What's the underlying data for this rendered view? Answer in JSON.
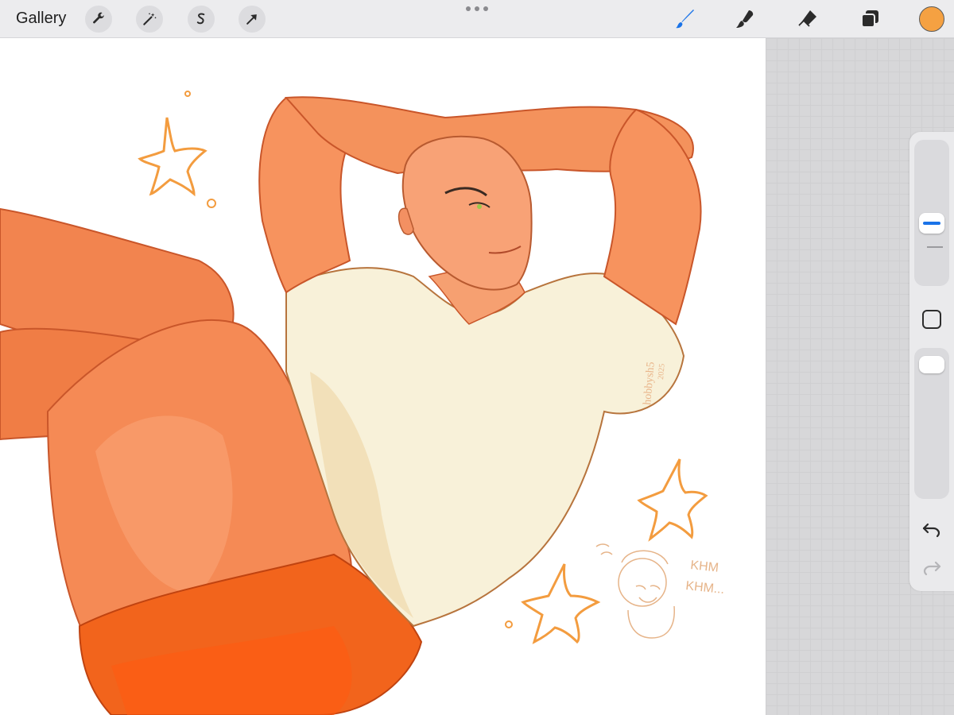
{
  "toolbar": {
    "gallery_label": "Gallery",
    "left_tools": [
      {
        "icon": "wrench-icon",
        "name": "actions"
      },
      {
        "icon": "magic-wand-icon",
        "name": "adjustments"
      },
      {
        "icon": "selection-s-icon",
        "name": "selection"
      },
      {
        "icon": "arrow-cursor-icon",
        "name": "transform"
      }
    ],
    "right_tools": [
      {
        "icon": "brush-icon",
        "name": "paint",
        "active_color": "#1a73e8"
      },
      {
        "icon": "smudge-icon",
        "name": "smudge"
      },
      {
        "icon": "eraser-icon",
        "name": "erase"
      },
      {
        "icon": "layers-icon",
        "name": "layers"
      }
    ],
    "current_color": "#f5a142"
  },
  "canvas": {
    "signature_text": "hobbysh5",
    "signature_year": "2025",
    "doodle_text_1": "KHM",
    "doodle_text_2": "KHM..."
  },
  "sidebar": {
    "size_slider_label": "brush-size",
    "opacity_slider_label": "brush-opacity",
    "accent": "#1a73e8"
  }
}
